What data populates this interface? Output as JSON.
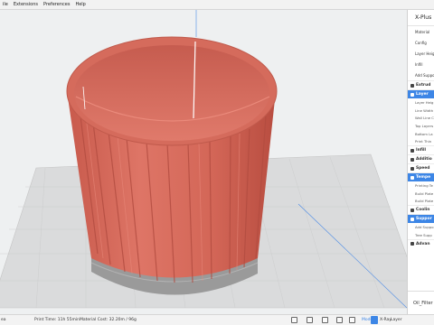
{
  "menu": [
    "ile",
    "Extensions",
    "Preferences",
    "Help"
  ],
  "panel": {
    "title": "X-Plus",
    "print_settings": [
      "Material",
      "Config",
      "Layer Heigh",
      "Infill",
      "Add Suppo"
    ],
    "categories": [
      {
        "label": "Extrud",
        "active": false,
        "settings": []
      },
      {
        "label": "Layer",
        "active": true,
        "settings": [
          "Layer Heig",
          "Line Width",
          "Wall Line C",
          "Top Layers",
          "Bottom La",
          "Print Thin"
        ]
      },
      {
        "label": "Infill",
        "active": false,
        "settings": []
      },
      {
        "label": "Additio",
        "active": false,
        "settings": []
      },
      {
        "label": "Speed",
        "active": false,
        "settings": []
      },
      {
        "label": "Tempe",
        "active": true,
        "settings": [
          "Printing Te",
          "Build Plate",
          "Build Plate"
        ]
      },
      {
        "label": "Coolin",
        "active": false,
        "settings": []
      },
      {
        "label": "Suppor",
        "active": true,
        "settings": [
          "Add Suppo",
          "Tree Supp"
        ]
      },
      {
        "label": "Advan",
        "active": false,
        "settings": []
      }
    ],
    "footer_label": "Oil_Filter"
  },
  "status": {
    "left": "ea",
    "print_time": "Print Time: 11h 55min",
    "material_cost": "Material Cost: 32.20m / 96g",
    "views": [
      "Model",
      "X-Ray",
      "Layer"
    ],
    "selected_view": "Model"
  },
  "colors": {
    "model": "#d66a5c",
    "model_dark": "#b54b40",
    "base": "#9b9b9b",
    "plate": "#dcdcdc",
    "accent": "#3d86e6"
  }
}
